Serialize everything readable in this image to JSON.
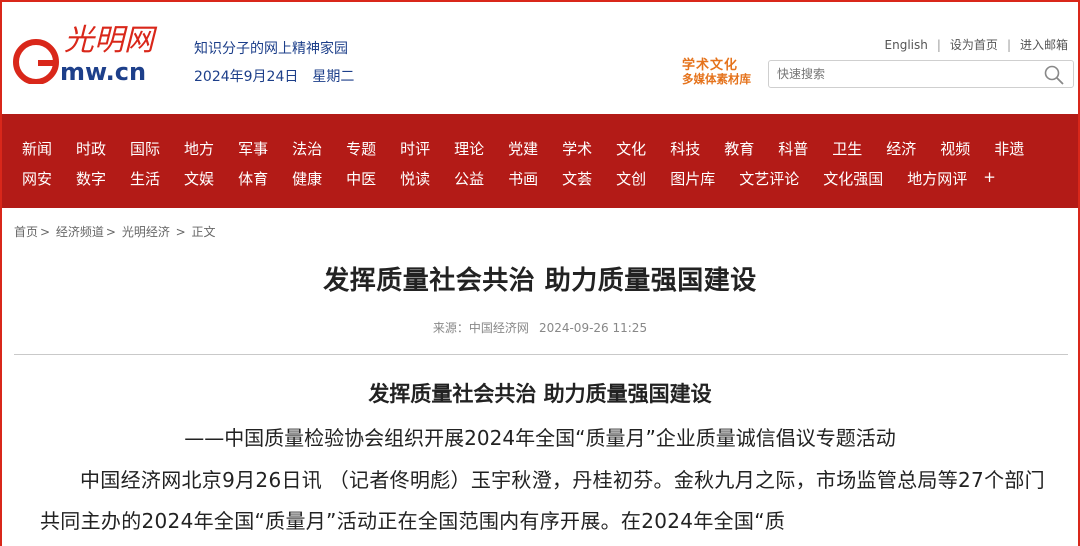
{
  "site": {
    "logo_text": "光明网",
    "logo_domain": "mw.cn",
    "tagline": "知识分子的网上精神家园",
    "date": "2024年9月24日",
    "weekday": "星期二"
  },
  "top_links": {
    "english": "English",
    "homepage": "设为首页",
    "mail": "进入邮箱"
  },
  "brand_badge": {
    "line1": "学术文化",
    "line2": "多媒体素材库"
  },
  "search": {
    "placeholder": "快速搜索"
  },
  "nav": {
    "row1": [
      "新闻",
      "时政",
      "国际",
      "地方",
      "军事",
      "法治",
      "专题",
      "时评",
      "理论",
      "党建",
      "学术",
      "文化",
      "科技",
      "教育",
      "科普",
      "卫生",
      "经济",
      "视频",
      "非遗"
    ],
    "row2": [
      "网安",
      "数字",
      "生活",
      "文娱",
      "体育",
      "健康",
      "中医",
      "悦读",
      "公益",
      "书画",
      "文荟",
      "文创",
      "图片库",
      "文艺评论",
      "文化强国",
      "地方网评"
    ],
    "more": "+"
  },
  "breadcrumb": {
    "home": "首页",
    "channel": "经济频道",
    "section": "光明经济",
    "current": "正文"
  },
  "article": {
    "title": "发挥质量社会共治 助力质量强国建设",
    "source": "来源：中国经济网",
    "datetime": "2024-09-26 11:25",
    "subtitle": "发挥质量社会共治 助力质量强国建设",
    "subline": "——中国质量检验协会组织开展2024年全国“质量月”企业质量诚信倡议专题活动",
    "paragraph": "中国经济网北京9月26日讯 （记者佟明彪）玉宇秋澄，丹桂初芬。金秋九月之际，市场监管总局等27个部门共同主办的2024年全国“质量月”活动正在全国范围内有序开展。在2024年全国“质"
  },
  "colors": {
    "nav_bg": "#b31b17",
    "logo_red": "#d9271a",
    "logo_blue": "#1d3f8a",
    "badge_orange": "#e5731c"
  }
}
